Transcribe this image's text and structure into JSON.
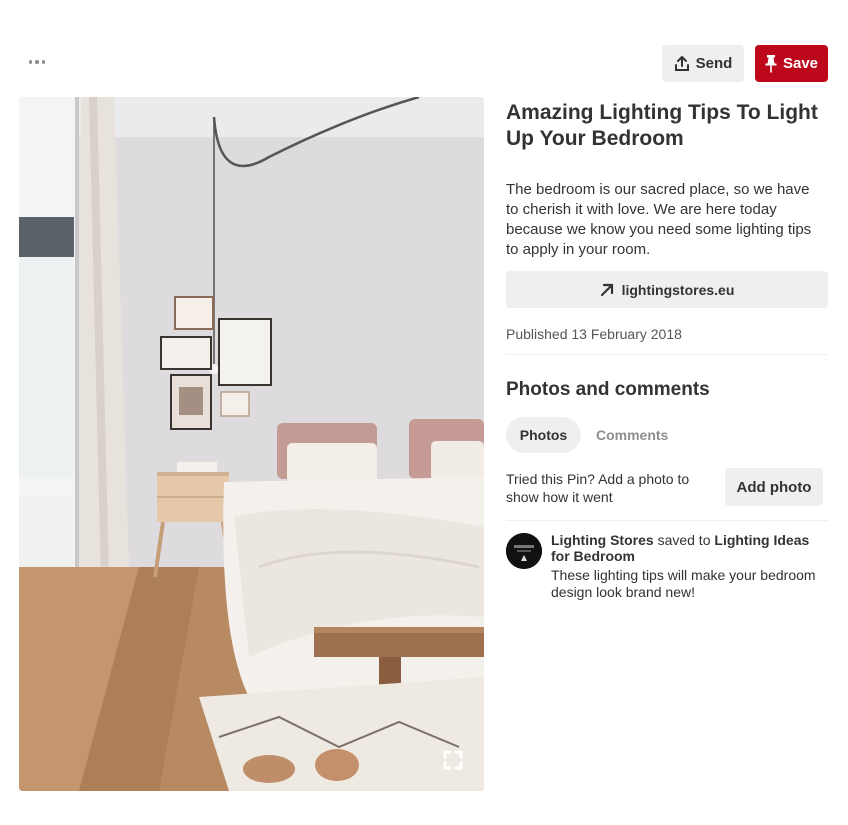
{
  "toolbar": {
    "more_icon": "ellipsis-icon",
    "send_label": "Send",
    "send_icon": "share-upload-icon",
    "save_label": "Save",
    "save_icon": "pushpin-icon",
    "save_color": "#bd081c"
  },
  "pin": {
    "image_alt": "Bright bedroom with hanging pendant light, framed art, pink pillows and wooden bench",
    "expand_icon": "expand-icon",
    "title": "Amazing Lighting Tips To Light Up Your Bedroom",
    "description": "The bedroom is our sacred place, so we have to cherish it with love. We are here today because we know you need some lighting tips to apply in your room.",
    "link_label": "lightingstores.eu",
    "link_icon": "arrow-up-right-icon",
    "published": "Published 13 February 2018"
  },
  "photos_comments": {
    "heading": "Photos and comments",
    "tabs": [
      {
        "label": "Photos",
        "active": true
      },
      {
        "label": "Comments",
        "active": false
      }
    ],
    "tried_text": "Tried this Pin? Add a photo to show how it went",
    "add_photo_label": "Add photo"
  },
  "activity": {
    "user": "Lighting Stores",
    "saved_to": "saved to",
    "board": "Lighting Ideas for Bedroom",
    "comment": "These lighting tips will make your bedroom design look brand new!"
  }
}
